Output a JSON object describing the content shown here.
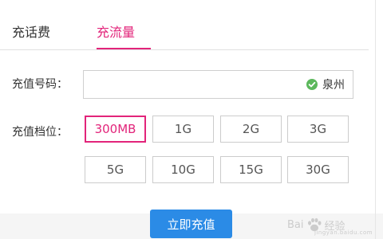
{
  "tabs": [
    {
      "label": "充话费",
      "active": false
    },
    {
      "label": "充流量",
      "active": true
    }
  ],
  "form": {
    "phone_label": "充值号码：",
    "phone_value": "",
    "location": "泉州",
    "amount_label": "充值档位：",
    "options": [
      "300MB",
      "1G",
      "2G",
      "3G",
      "5G",
      "10G",
      "15G",
      "30G"
    ],
    "selected": "300MB"
  },
  "submit_label": "立即充值",
  "watermark": {
    "brand_left": "Bai",
    "brand_right": "经验",
    "sub": "jingyan.baidu.com"
  },
  "colors": {
    "accent": "#e2247a",
    "button": "#2b8be6",
    "check": "#5cb85c"
  }
}
